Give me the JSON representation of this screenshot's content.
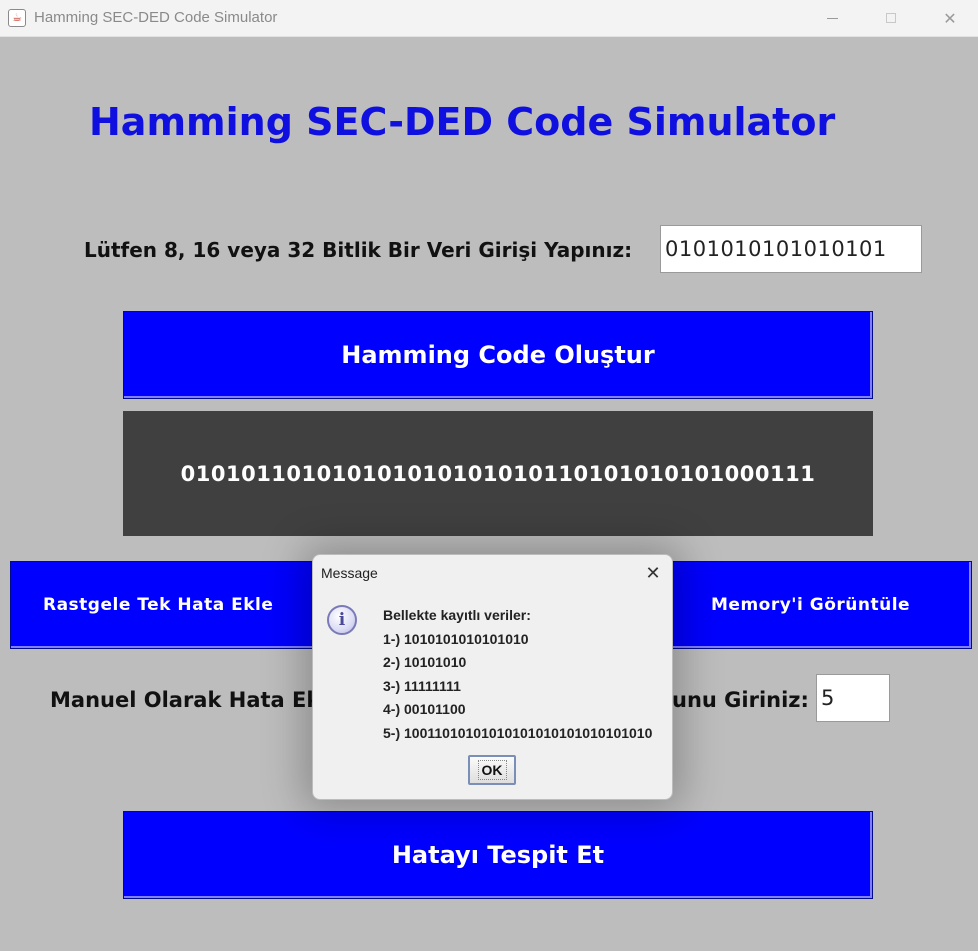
{
  "window": {
    "title": "Hamming SEC-DED Code Simulator"
  },
  "main": {
    "title": "Hamming SEC-DED Code Simulator",
    "input_label": "Lütfen 8, 16 veya 32 Bitlik Bir Veri Girişi Yapınız:",
    "input_value": "0101010101010101",
    "generate_button": "Hamming Code Oluştur",
    "code_output": "010101101010101010101010110101010101000111",
    "random_error_button": "Rastgele Tek Hata Ekle",
    "memory_button": "Memory'i Görüntüle",
    "manual_label_visible": "Manuel Olarak Hata Ek",
    "manual_label_tail": "unu Giriniz:",
    "position_value": "5",
    "detect_button": "Hatayı Tespit Et"
  },
  "dialog": {
    "title": "Message",
    "icon": "info-icon",
    "lines": [
      "Bellekte kayıtlı veriler:",
      "1-) 1010101010101010",
      "2-) 10101010",
      "3-) 11111111",
      "4-) 00101100",
      "5-) 10011010101010101010101010101010"
    ],
    "ok_label": "OK"
  },
  "colors": {
    "title_blue": "#0f0fe0",
    "button_blue": "#0000ff",
    "output_bg": "#404040",
    "background": "#bdbdbd"
  }
}
